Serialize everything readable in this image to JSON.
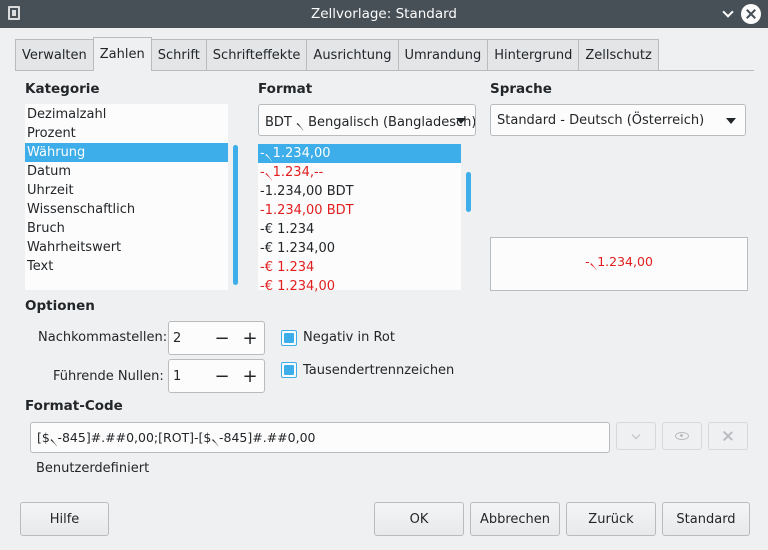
{
  "window": {
    "title": "Zellvorlage: Standard",
    "app_icon": "document-icon",
    "minimize_icon": "chevron-down-icon",
    "close_icon": "close-icon"
  },
  "tabs": [
    "Verwalten",
    "Zahlen",
    "Schrift",
    "Schrifteffekte",
    "Ausrichtung",
    "Umrandung",
    "Hintergrund",
    "Zellschutz"
  ],
  "active_tab": "Zahlen",
  "category": {
    "label": "Kategorie",
    "items": [
      "Dezimalzahl",
      "Prozent",
      "Währung",
      "Datum",
      "Uhrzeit",
      "Wissenschaftlich",
      "Bruch",
      "Wahrheitswert",
      "Text"
    ],
    "selected": "Währung"
  },
  "format": {
    "label": "Format",
    "currency_select": "BDT ৲ Bengalisch (Bangladesch)",
    "items": [
      {
        "text": "-৲1.234,00",
        "negative_red": false,
        "selected": true
      },
      {
        "text": "-৲1.234,--",
        "negative_red": true
      },
      {
        "text": "-1.234,00 BDT",
        "negative_red": false
      },
      {
        "text": "-1.234,00 BDT",
        "negative_red": true
      },
      {
        "text": "-€ 1.234",
        "negative_red": false
      },
      {
        "text": "-€ 1.234,00",
        "negative_red": false
      },
      {
        "text": "-€ 1.234",
        "negative_red": true
      },
      {
        "text": "-€ 1.234,00",
        "negative_red": true
      }
    ]
  },
  "language": {
    "label": "Sprache",
    "select": "Standard - Deutsch (Österreich)"
  },
  "preview": {
    "text": "-৲1.234,00",
    "color": "#e11e1e"
  },
  "options": {
    "label": "Optionen",
    "decimals_label": "Nachkommastellen:",
    "decimals_value": "2",
    "leading_zeros_label": "Führende Nullen:",
    "leading_zeros_value": "1",
    "minus_symbol": "−",
    "plus_symbol": "+",
    "negative_red_label": "Negativ in Rot",
    "negative_red_checked": true,
    "thousands_label": "Tausendertrennzeichen",
    "thousands_checked": true
  },
  "format_code": {
    "label": "Format-Code",
    "value": "[$৲-845]#.##0,00;[ROT]-[$৲-845]#.##0,00",
    "description": "Benutzerdefiniert",
    "icons": [
      "accept-icon",
      "edit-comment-icon",
      "delete-icon"
    ]
  },
  "buttons": {
    "help": "Hilfe",
    "ok": "OK",
    "cancel": "Abbrechen",
    "reset": "Zurück",
    "standard": "Standard"
  },
  "colors": {
    "accent": "#3daee9",
    "negative": "#e11e1e",
    "titlebar": "#475057"
  }
}
